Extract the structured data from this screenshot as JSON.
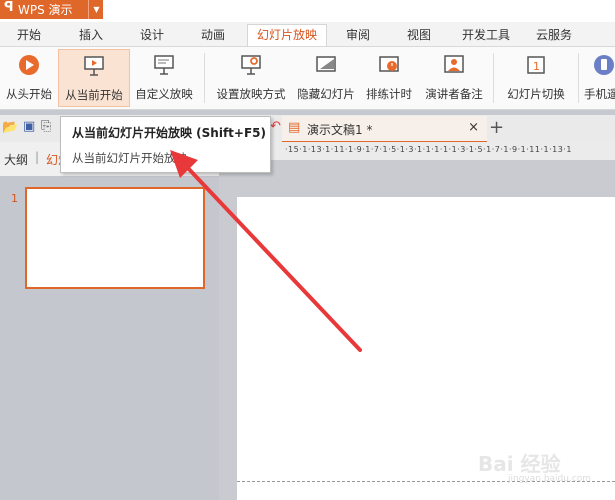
{
  "app": {
    "name": "WPS 演示"
  },
  "tabs": [
    "开始",
    "插入",
    "设计",
    "动画",
    "幻灯片放映",
    "审阅",
    "视图",
    "开发工具",
    "云服务"
  ],
  "ribbon": {
    "from_start": "从头开始",
    "from_current": "从当前开始",
    "custom_show": "自定义放映",
    "setup_show": "设置放映方式",
    "hide_slide": "隐藏幻灯片",
    "rehearse": "排练计时",
    "presenter_notes": "演讲者备注",
    "slide_transition": "幻灯片切换",
    "phone": "手机遥"
  },
  "document_tab": {
    "name": "演示文稿1 *"
  },
  "panel": {
    "outline": "大纲",
    "slides": "幻灯片",
    "slide_number": "1"
  },
  "tooltip": {
    "title": "从当前幻灯片开始放映 (Shift+F5)",
    "body": "从当前幻灯片开始放映。"
  },
  "ruler": {
    "labels": "·15·1·13·1·11·1·9·1·7·1·5·1·3·1·1·1·1·1·3·1·5·1·7·1·9·1·11·1·13·1"
  },
  "watermark": {
    "main": "Bai 经验",
    "sub": "jingyan.baidu.com"
  },
  "colors": {
    "accent": "#e0672a",
    "arrow": "#e8383a"
  }
}
